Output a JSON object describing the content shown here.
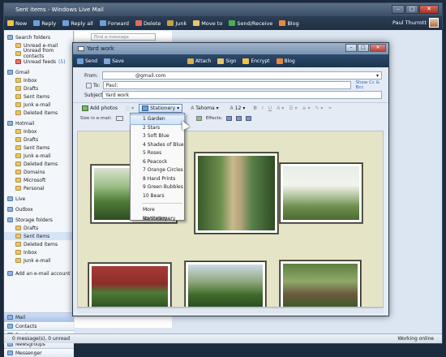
{
  "main": {
    "title": "Sent items - Windows Live Mail",
    "toolbar": [
      {
        "label": "New",
        "icon": "new-mail-icon"
      },
      {
        "label": "Reply",
        "icon": "reply-icon"
      },
      {
        "label": "Reply all",
        "icon": "reply-all-icon"
      },
      {
        "label": "Forward",
        "icon": "forward-icon"
      },
      {
        "label": "Delete",
        "icon": "delete-icon"
      },
      {
        "label": "Junk",
        "icon": "junk-icon"
      },
      {
        "label": "Move to",
        "icon": "move-icon"
      },
      {
        "label": "Send/Receive",
        "icon": "send-receive-icon"
      },
      {
        "label": "Blog",
        "icon": "blog-icon"
      }
    ],
    "user_name": "Paul Thurrott",
    "search_placeholder": "Find a message"
  },
  "sidebar": {
    "sections": [
      {
        "title": "Search folders",
        "items": [
          {
            "label": "Unread e-mail",
            "count": ""
          },
          {
            "label": "Unread from contacts",
            "count": ""
          },
          {
            "label": "Unread feeds",
            "count": "(5)"
          }
        ]
      },
      {
        "title": "Gmail",
        "items": [
          {
            "label": "Inbox",
            "count": ""
          },
          {
            "label": "Drafts",
            "count": ""
          },
          {
            "label": "Sent items",
            "count": ""
          },
          {
            "label": "Junk e-mail",
            "count": ""
          },
          {
            "label": "Deleted items",
            "count": ""
          }
        ]
      },
      {
        "title": "Hotmail",
        "items": [
          {
            "label": "Inbox",
            "count": ""
          },
          {
            "label": "Drafts",
            "count": ""
          },
          {
            "label": "Sent items",
            "count": ""
          },
          {
            "label": "Junk e-mail",
            "count": ""
          },
          {
            "label": "Deleted items",
            "count": ""
          },
          {
            "label": "Domains",
            "count": ""
          },
          {
            "label": "Microsoft",
            "count": ""
          },
          {
            "label": "Personal",
            "count": ""
          }
        ]
      },
      {
        "title": "Live",
        "items": []
      },
      {
        "title": "Outbox",
        "items": []
      },
      {
        "title": "Storage folders",
        "items": [
          {
            "label": "Drafts",
            "count": ""
          },
          {
            "label": "Sent items",
            "count": ""
          },
          {
            "label": "Deleted items",
            "count": ""
          },
          {
            "label": "Inbox",
            "count": ""
          },
          {
            "label": "Junk e-mail",
            "count": ""
          }
        ]
      }
    ],
    "add_account": "Add an e-mail account",
    "nav_tabs": [
      "Mail",
      "Contacts",
      "Feeds",
      "Newsgroups",
      "Messenger"
    ]
  },
  "statusbar": {
    "left": "0 message(s), 0 unread",
    "right": "Working online"
  },
  "compose": {
    "title": "Yard work",
    "toolbar": [
      "Send",
      "Save",
      "Attach",
      "Sign",
      "Encrypt",
      "Blog"
    ],
    "from_label": "From:",
    "from_value": "@gmail.com",
    "to_label": "To:",
    "to_value": "Paul;",
    "show_cc": "Show Cc & Bcc",
    "subject_label": "Subject:",
    "subject_value": "Yard work",
    "format": {
      "add_photos": "Add photos",
      "stationery": "Stationery",
      "font": "Tahoma",
      "size": "12"
    },
    "size_row": {
      "size_in_email": "Size in e-mail:",
      "effects": "Effects:"
    }
  },
  "stationery_menu": {
    "items": [
      "1 Garden",
      "2 Stars",
      "3 Soft Blue",
      "4 Shades of Blue",
      "5 Roses",
      "6 Peacock",
      "7 Orange Circles",
      "8 Hand Prints",
      "9 Green Bubbles",
      "10 Bears"
    ],
    "more": "More stationery...",
    "none": "No stationery",
    "highlighted_index": 0
  }
}
